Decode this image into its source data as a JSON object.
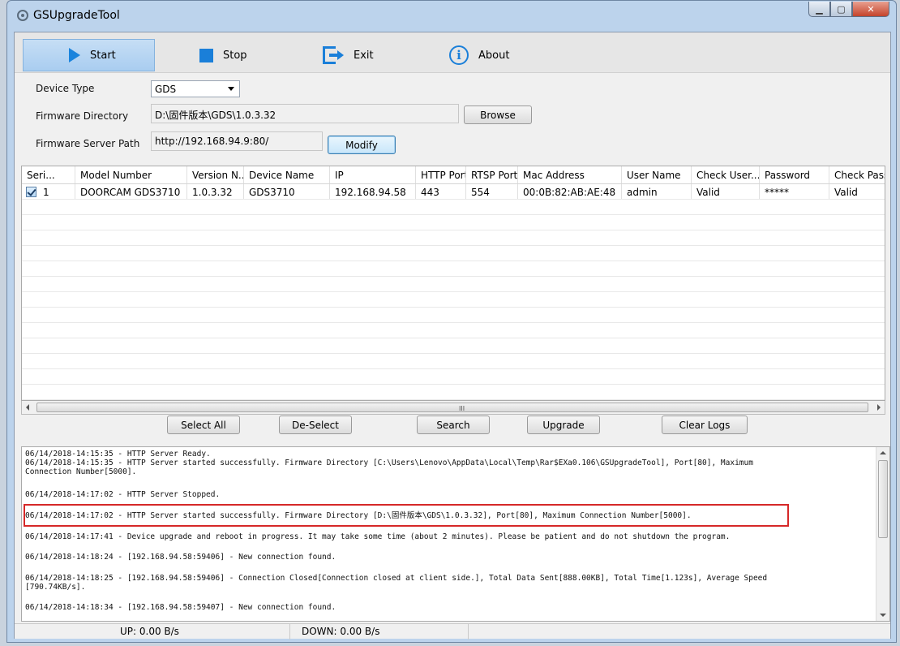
{
  "window": {
    "title": "GSUpgradeTool"
  },
  "toolbar": {
    "start_label": "Start",
    "stop_label": "Stop",
    "exit_label": "Exit",
    "about_label": "About",
    "accent_color": "#1a84dd"
  },
  "form": {
    "device_type_label": "Device Type",
    "device_type_value": "GDS",
    "firmware_dir_label": "Firmware Directory",
    "firmware_dir_value": "D:\\固件版本\\GDS\\1.0.3.32",
    "browse_label": "Browse",
    "server_path_label": "Firmware Server Path",
    "server_path_value": "http://192.168.94.9:80/",
    "modify_label": "Modify"
  },
  "grid": {
    "columns": [
      "Seri...",
      "Model Number",
      "Version N...",
      "Device Name",
      "IP",
      "HTTP Port",
      "RTSP Port",
      "Mac Address",
      "User Name",
      "Check User...",
      "Password",
      "Check Pass..."
    ],
    "rows": [
      [
        "1",
        "DOORCAM GDS3710",
        "1.0.3.32",
        "GDS3710",
        "192.168.94.58",
        "443",
        "554",
        "00:0B:82:AB:AE:48",
        "admin",
        "Valid",
        "*****",
        "Valid"
      ]
    ],
    "scroll_grip": "III"
  },
  "actions": {
    "select_all": "Select All",
    "deselect": "De-Select",
    "search": "Search",
    "upgrade": "Upgrade",
    "clear_logs": "Clear Logs"
  },
  "log": {
    "entries": [
      "06/14/2018-14:15:35 - HTTP Server Ready.\n06/14/2018-14:15:35 - HTTP Server started successfully. Firmware Directory [C:\\Users\\Lenovo\\AppData\\Local\\Temp\\Rar$EXa0.106\\GSUpgradeTool], Port[80], Maximum\nConnection Number[5000].",
      "06/14/2018-14:17:02 - HTTP Server Stopped.",
      "06/14/2018-14:17:02 - HTTP Server started successfully. Firmware Directory [D:\\固件版本\\GDS\\1.0.3.32], Port[80], Maximum Connection Number[5000].",
      "06/14/2018-14:17:41 - Device upgrade and reboot in progress. It may take some time (about 2 minutes). Please be patient and do not shutdown the program.",
      "06/14/2018-14:18:24 - [192.168.94.58:59406] - New connection found.",
      "06/14/2018-14:18:25 - [192.168.94.58:59406] - Connection Closed[Connection closed at client side.], Total Data Sent[888.00KB], Total Time[1.123s], Average Speed\n[790.74KB/s].",
      "06/14/2018-14:18:34 - [192.168.94.58:59407] - New connection found."
    ],
    "highlight_color": "#d62828"
  },
  "status": {
    "up": "UP: 0.00 B/s",
    "down": "DOWN: 0.00 B/s"
  }
}
